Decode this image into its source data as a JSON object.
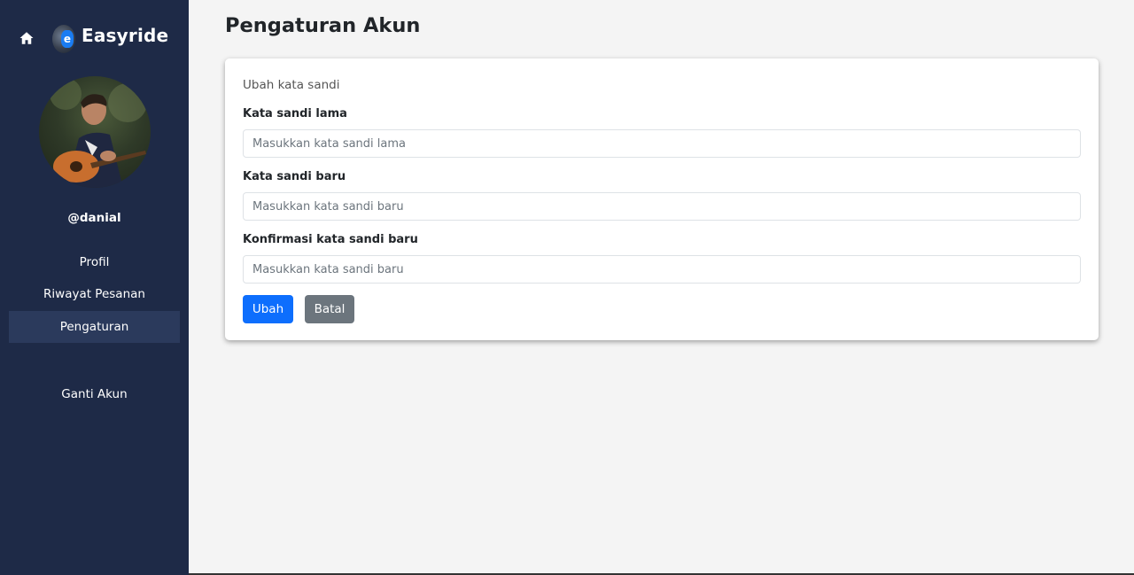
{
  "brand": {
    "name": "Easyride",
    "logo_letter": "e"
  },
  "user": {
    "username": "@danial"
  },
  "sidebar": {
    "items": [
      {
        "label": "Profil"
      },
      {
        "label": "Riwayat Pesanan"
      },
      {
        "label": "Pengaturan",
        "active": true
      },
      {
        "label": "Ganti Akun"
      }
    ]
  },
  "page": {
    "title": "Pengaturan Akun"
  },
  "form": {
    "subtitle": "Ubah kata sandi",
    "fields": [
      {
        "label": "Kata sandi lama",
        "placeholder": "Masukkan kata sandi lama",
        "value": ""
      },
      {
        "label": "Kata sandi baru",
        "placeholder": "Masukkan kata sandi baru",
        "value": ""
      },
      {
        "label": "Konfirmasi kata sandi baru",
        "placeholder": "Masukkan kata sandi baru",
        "value": ""
      }
    ],
    "submit_label": "Ubah",
    "cancel_label": "Batal"
  },
  "colors": {
    "sidebar_bg": "#1e2a47",
    "active_item_bg": "#2b3a5c",
    "primary": "#0d6efd",
    "secondary": "#6c757d"
  },
  "icons": {
    "home": "home-icon",
    "logo": "logo-icon"
  }
}
